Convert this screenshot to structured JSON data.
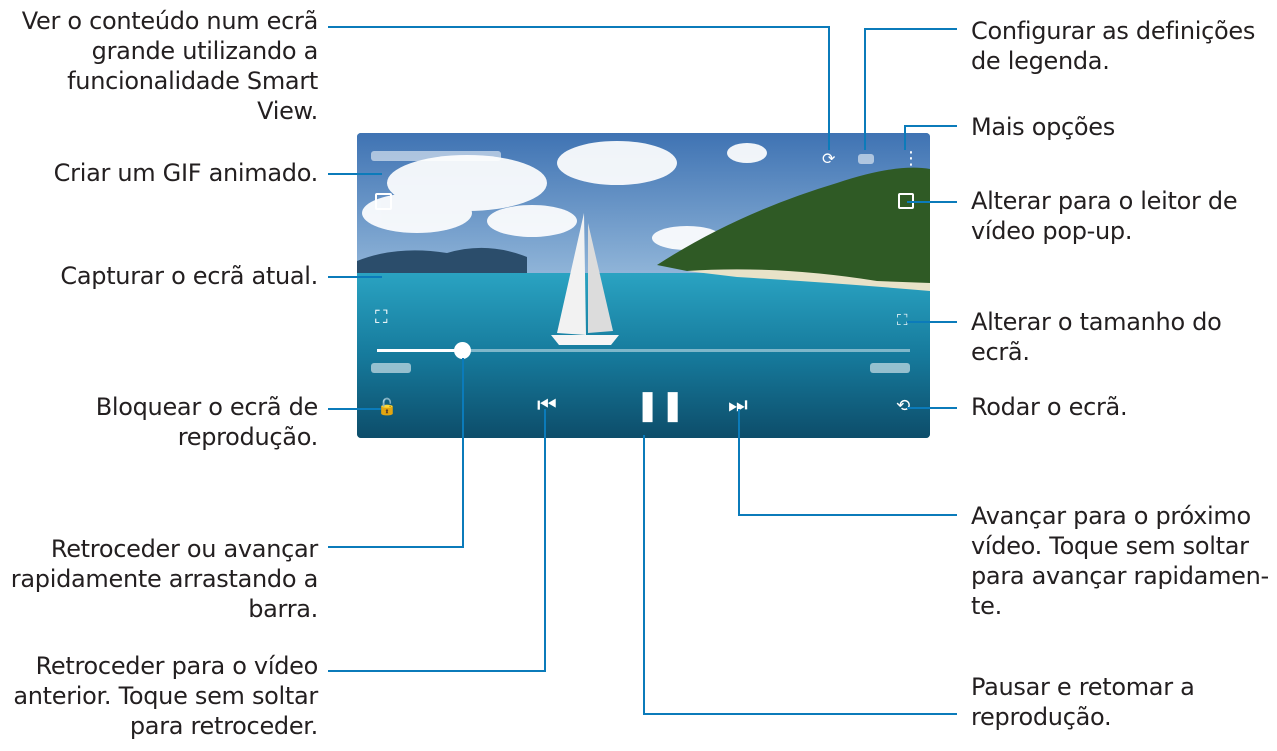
{
  "player": {
    "icons": {
      "gif": "gif-icon",
      "capture": "capture-icon",
      "lock": "lock-icon",
      "smart_view": "smart-view-icon",
      "subtitles": "subtitles-icon",
      "more": "more-options-icon",
      "popup": "popup-player-icon",
      "ratio": "screen-ratio-icon",
      "rotate": "rotate-icon",
      "previous": "previous-icon",
      "pause": "pause-icon",
      "next": "next-icon"
    },
    "progress": 0.16,
    "colors": {
      "sea": "#1a6f93",
      "sky": "#5e8fc4",
      "island": "#2f5a25",
      "leader": "#0b7bba"
    }
  },
  "callouts": {
    "smart_view": [
      "Ver o conteúdo num ecrã",
      "grande utilizando a",
      "funcionalidade Smart",
      "View."
    ],
    "gif": [
      "Criar um GIF animado."
    ],
    "capture": [
      "Capturar o ecrã atual."
    ],
    "lock": [
      "Bloquear o ecrã de",
      "reprodução."
    ],
    "seek": [
      "Retroceder ou avançar",
      "rapidamente arrastando a",
      "barra."
    ],
    "previous": [
      "Retroceder para o vídeo",
      "anterior. Toque sem soltar",
      "para retroceder."
    ],
    "subtitles": [
      "Configurar as definições",
      "de legenda."
    ],
    "more": [
      "Mais opções"
    ],
    "popup": [
      "Alterar para o leitor de",
      "vídeo pop-up."
    ],
    "ratio": [
      "Alterar o tamanho do",
      "ecrã."
    ],
    "rotate": [
      "Rodar o ecrã."
    ],
    "next": [
      "Avançar para o próximo",
      "vídeo. Toque sem soltar",
      "para avançar rapidamen-",
      "te."
    ],
    "pause": [
      "Pausar e retomar a",
      "reprodução."
    ]
  }
}
